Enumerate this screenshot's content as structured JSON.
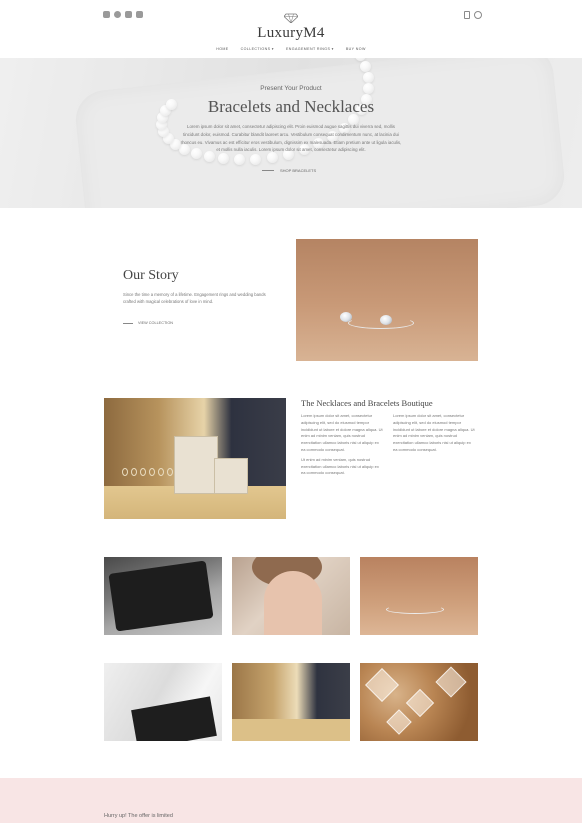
{
  "header": {
    "brand": "LuxuryM4",
    "social_icons": [
      "instagram-icon",
      "globe-icon",
      "shield-icon",
      "send-icon"
    ],
    "utility_icons": [
      "phone-icon",
      "user-icon"
    ],
    "nav": [
      {
        "label": "HOME"
      },
      {
        "label": "COLLECTIONS ▾"
      },
      {
        "label": "ENGAGEMENT RINGS ▾"
      },
      {
        "label": "BUY NOW"
      }
    ]
  },
  "hero": {
    "kicker": "Present Your Product",
    "title": "Bracelets and Necklaces",
    "description": "Lorem ipsum dolor sit amet, consectetur adipiscing elit. Proin euismod augue sagittis dui viverra sed, mollis tincidunt dolor, euismod. Curabitur blandit laoreet arcu. Vestibulum consequat condimentum nunc, at lacinia dui rhoncus eu. Vivamus ac est efficitur eros vestibulum, dignissim ex malesuada. Etiam pretium ante ut ligula iaculis, et mollis nulla iaculis. Lorem ipsum dolor sit amet, consectetur adipiscing elit.",
    "cta": "SHOP BRACELETS"
  },
  "story": {
    "title": "Our Story",
    "text": "Since the time a memory of a lifetime. Engagement rings and wedding bands crafted with magical celebrations of love in mind.",
    "link": "VIEW COLLECTION"
  },
  "boutique": {
    "title": "The Necklaces and Bracelets Boutique",
    "col1": "Lorem ipsum dolor sit amet, consectetur adipiscing elit, sed do eiusmod tempor incididunt ut labore et dolore magna aliqua. Ut enim ad minim veniam, quis nostrud exercitation ullamco laboris nisi ut aliquip ex ea commodo consequat.",
    "col1b": "Ut enim ad minim veniam, quis nostrud exercitation ullamco laboris nisi ut aliquip ex ea commodo consequat.",
    "col2": "Lorem ipsum dolor sit amet, consectetur adipiscing elit, sed do eiusmod tempor incididunt ut labore et dolore magna aliqua. Ut enim ad minim veniam, quis nostrud exercitation ullamco laboris nisi ut aliquip ex ea commodo consequat."
  },
  "promo": {
    "text": "Hurry up! The offer is limited"
  }
}
